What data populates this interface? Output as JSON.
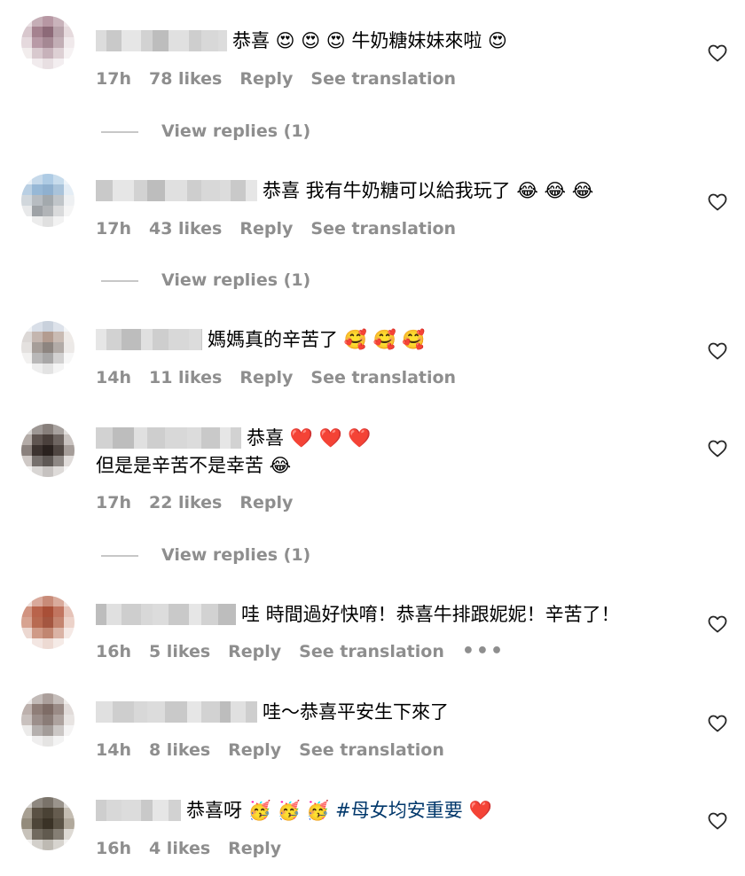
{
  "comments": [
    {
      "text_lines": [
        "恭喜 😍 😍 😍 牛奶糖妹妹來啦 😍"
      ],
      "time": "17h",
      "likes": "78 likes",
      "reply": "Reply",
      "translate": "See translation",
      "view_replies": "View replies (1)",
      "avatar_colors": [
        "#e9dfe2",
        "#c5aeb6",
        "#b797a3",
        "#c9b3bb",
        "#eee4e7",
        "#d8c7cd",
        "#a5828f",
        "#8d6a78",
        "#b7a1a9",
        "#e6dadd",
        "#e5d9dd",
        "#b89aa6",
        "#a58893",
        "#c2aeb5",
        "#f0e9eb",
        "#f2eded",
        "#d8c9ce",
        "#c7b2ba",
        "#ddd0d4",
        "#f6f2f3",
        "#ffffff",
        "#f1ebed",
        "#e8dfe2",
        "#f3eef0",
        "#ffffff"
      ]
    },
    {
      "text_lines": [
        "恭喜 我有牛奶糖可以給我玩了 😂 😂 😂"
      ],
      "time": "17h",
      "likes": "43 likes",
      "reply": "Reply",
      "translate": "See translation",
      "view_replies": "View replies (1)",
      "avatar_colors": [
        "#eaf1f7",
        "#c6d9ea",
        "#aecbe4",
        "#c8dcec",
        "#eef4f9",
        "#b9cfe3",
        "#97b8d6",
        "#8fb0cf",
        "#a9c3da",
        "#e4edf5",
        "#d1d7dc",
        "#b7bcc1",
        "#a3a9ad",
        "#c0c5c9",
        "#eef0f2",
        "#e8e9ea",
        "#9ea2a6",
        "#b1b4b7",
        "#d9dadb",
        "#f5f5f5",
        "#ffffff",
        "#ececec",
        "#e0e0e0",
        "#f2f2f2",
        "#ffffff"
      ]
    },
    {
      "text_lines": [
        "媽媽真的辛苦了 🥰 🥰 🥰"
      ],
      "time": "14h",
      "likes": "11 likes",
      "reply": "Reply",
      "translate": "See translation",
      "view_replies": "",
      "avatar_colors": [
        "#f1f3f6",
        "#d9dfe8",
        "#c9d1dc",
        "#dde2ea",
        "#f4f6f8",
        "#dcd8d6",
        "#c4b6af",
        "#b39c90",
        "#c9bbb3",
        "#eeeae7",
        "#e4e1df",
        "#a69e99",
        "#8d8580",
        "#b2aba7",
        "#ece9e7",
        "#f2f1f0",
        "#b9b8b8",
        "#a8a7a7",
        "#d2d1d1",
        "#f7f7f7",
        "#ffffff",
        "#eeeeee",
        "#e3e3e3",
        "#f4f4f4",
        "#ffffff"
      ]
    },
    {
      "text_lines": [
        "恭喜 ❤️ ❤️ ❤️",
        "但是是辛苦不是幸苦 😂"
      ],
      "time": "17h",
      "likes": "22 likes",
      "reply": "Reply",
      "translate": "",
      "view_replies": "View replies (1)",
      "avatar_colors": [
        "#d8d5d3",
        "#9d9794",
        "#877f7b",
        "#a8a29f",
        "#e2dfdd",
        "#b3aba7",
        "#5f5551",
        "#4a403c",
        "#6e6561",
        "#c9c3c0",
        "#8a817d",
        "#3c3330",
        "#2a221f",
        "#4f4642",
        "#a59d99",
        "#cfc9c6",
        "#76706d",
        "#5e5855",
        "#8e8885",
        "#e0dcda",
        "#f5f4f3",
        "#d9d6d4",
        "#c6c2c0",
        "#dedbd9",
        "#f7f6f6"
      ]
    },
    {
      "text_lines": [
        "哇 時間過好快唷！恭喜牛排跟妮妮！辛苦了！"
      ],
      "time": "16h",
      "likes": "5 likes",
      "reply": "Reply",
      "translate": "See translation",
      "more": "•••",
      "view_replies": "",
      "avatar_colors": [
        "#efdcd6",
        "#d9a99b",
        "#c88b78",
        "#d9ab9c",
        "#f1e0db",
        "#d19380",
        "#b9634b",
        "#a94f37",
        "#c17560",
        "#e6c3b8",
        "#d7a391",
        "#b86a51",
        "#a45640",
        "#c4846f",
        "#ecd2c9",
        "#ecd8d1",
        "#cf9a87",
        "#c18671",
        "#dab3a5",
        "#f5e9e5",
        "#ffffff",
        "#f3e6e2",
        "#eddad3",
        "#f5ebe7",
        "#ffffff"
      ]
    },
    {
      "text_lines": [
        "哇～恭喜平安生下來了"
      ],
      "time": "14h",
      "likes": "8 likes",
      "reply": "Reply",
      "translate": "See translation",
      "view_replies": "",
      "avatar_colors": [
        "#ece9e8",
        "#c2bab7",
        "#ab9f9b",
        "#c5bdba",
        "#efecea",
        "#bdb1ad",
        "#8f7e78",
        "#7e6c66",
        "#9a8b86",
        "#e1dbd9",
        "#c9c1be",
        "#9c8f8b",
        "#8a7c77",
        "#ada29e",
        "#e8e4e2",
        "#ecebea",
        "#b5b0ae",
        "#a39c99",
        "#cbc7c5",
        "#f5f4f4",
        "#ffffff",
        "#efeeee",
        "#e5e4e3",
        "#f3f3f3",
        "#ffffff"
      ]
    },
    {
      "text_lines": [
        "恭喜呀 🥳 🥳 🥳 #母女均安重要 ❤️"
      ],
      "time": "16h",
      "likes": "4 likes",
      "reply": "Reply",
      "translate": "",
      "view_replies": "",
      "avatar_colors": [
        "#d6d3cf",
        "#8e8880",
        "#7a736a",
        "#9a948c",
        "#dedbd7",
        "#a79f92",
        "#5a5144",
        "#4a4235",
        "#655c4f",
        "#c4bdb2",
        "#938b7c",
        "#4d4538",
        "#3a3226",
        "#5a5245",
        "#b1a99c",
        "#c7c2ba",
        "#716a5f",
        "#615a4f",
        "#857e74",
        "#dedad4",
        "#f3f2f0",
        "#d3d0cb",
        "#bebab3",
        "#d7d4cf",
        "#f5f4f3"
      ]
    }
  ]
}
